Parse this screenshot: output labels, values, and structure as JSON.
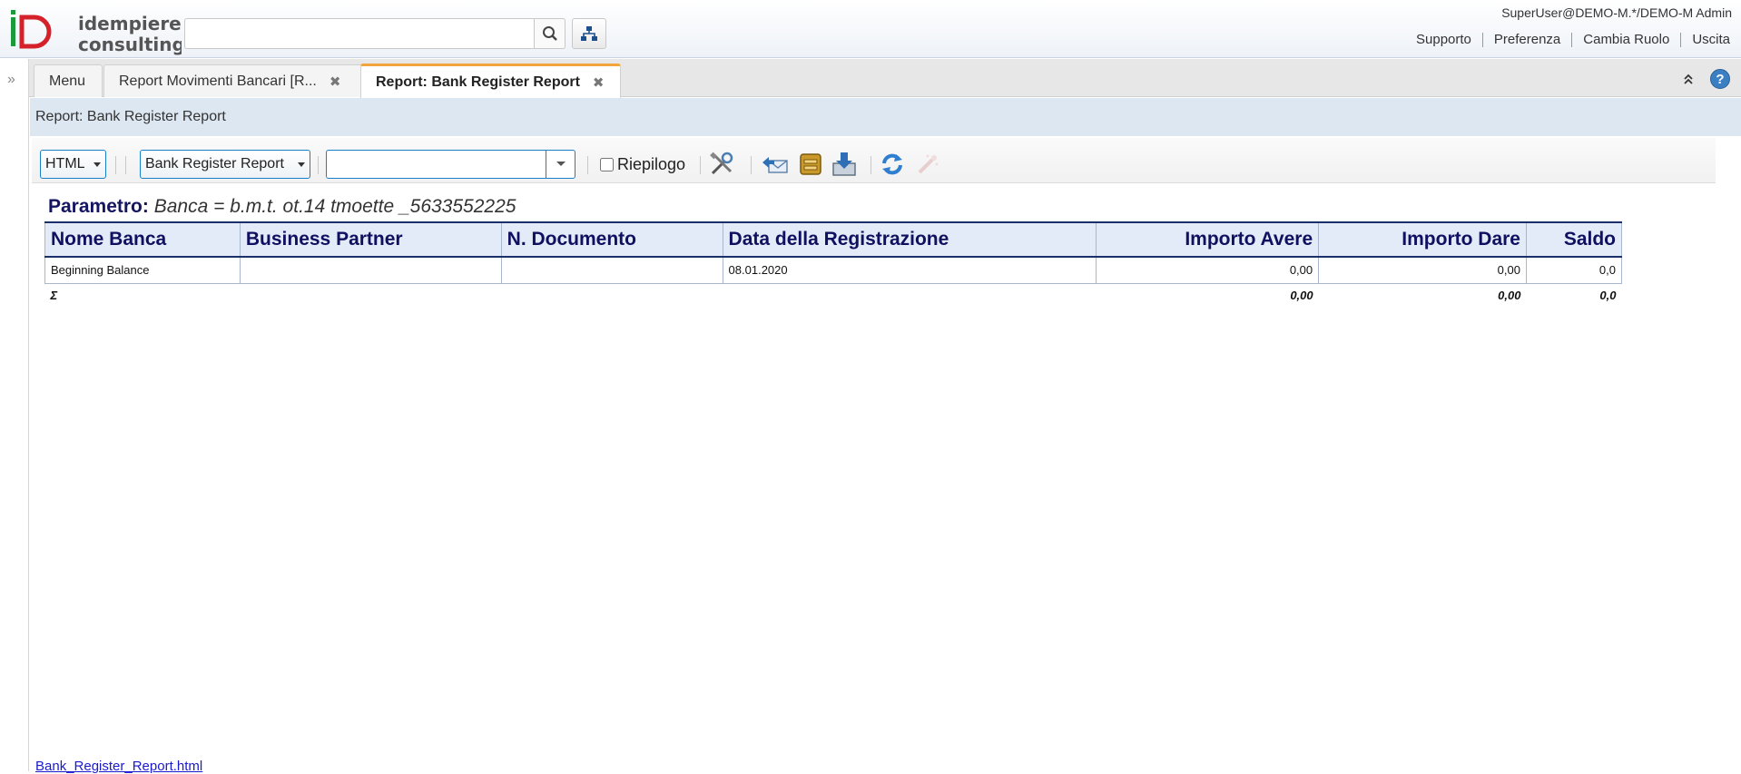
{
  "header": {
    "logo_text_line1": "idempiere",
    "logo_text_line2": "consulting",
    "search_placeholder": "",
    "user": "SuperUser@DEMO-M.*/DEMO-M Admin",
    "links": [
      "Supporto",
      "Preferenza",
      "Cambia Ruolo",
      "Uscita"
    ]
  },
  "tabs": [
    {
      "label": "Menu"
    },
    {
      "label": "Report Movimenti Bancari [R..."
    },
    {
      "label": "Report: Bank Register Report"
    }
  ],
  "title_band": "Report: Bank Register Report",
  "toolbar": {
    "format": "HTML",
    "report": "Bank Register Report",
    "view": "",
    "summary_label": "Riepilogo",
    "icons": [
      "customize-icon",
      "send-mail-icon",
      "archive-icon",
      "export-icon",
      "refresh-icon",
      "wizard-icon"
    ]
  },
  "report": {
    "param_label": "Parametro:",
    "param_value": "Banca = b.m.t. ot.14 tmoette _5633552225",
    "columns": [
      "Nome Banca",
      "Business Partner",
      "N. Documento",
      "Data della Registrazione",
      "Importo Avere",
      "Importo Dare",
      "Saldo"
    ],
    "rows": [
      [
        "Beginning Balance",
        "",
        "",
        "08.01.2020",
        "0,00",
        "0,00",
        "0,0"
      ]
    ],
    "total": [
      "Σ",
      "",
      "",
      "",
      "0,00",
      "0,00",
      "0,0"
    ]
  },
  "footer_link": "Bank_Register_Report.html",
  "colors": {
    "accent_tab": "#f2a53a",
    "header_text": "#101060",
    "title_band": "#dde7f1"
  }
}
